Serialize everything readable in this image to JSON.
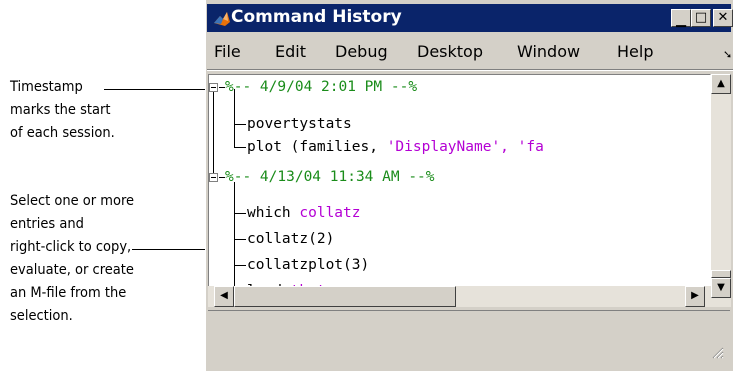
{
  "callouts": {
    "timestamp": {
      "lines": [
        "Timestamp",
        "marks the start",
        "of each session."
      ]
    },
    "select": {
      "lines": [
        "Select one or more",
        "entries and",
        "right-click to copy,",
        "evaluate, or create",
        "an M-file from the",
        "selection."
      ]
    }
  },
  "window": {
    "title": "Command History",
    "icon": "matlab-logo-icon",
    "controls": [
      "minimize-icon",
      "maximize-icon",
      "close-icon"
    ]
  },
  "menu": {
    "items": [
      "File",
      "Edit",
      "Debug",
      "Desktop",
      "Window",
      "Help"
    ],
    "overflow_icon": "chevron-double-right-icon"
  },
  "history": {
    "sessions": [
      {
        "timestamp": "%-- 4/9/04   2:01 PM --%",
        "entries": [
          {
            "text": "povertystats",
            "arg": ""
          },
          {
            "text": "plot (families, ",
            "arg": "'DisplayName', 'fa"
          }
        ]
      },
      {
        "timestamp": "%-- 4/13/04 11:34 AM --%",
        "entries": [
          {
            "text": "which ",
            "arg": "collatz"
          },
          {
            "text": "collatz(2)",
            "arg": ""
          },
          {
            "text": "collatzplot(3)",
            "arg": ""
          },
          {
            "text": "load ",
            "arg": "theta"
          }
        ]
      }
    ]
  },
  "colors": {
    "titlebar": "#0a246a",
    "timestamp": "#1a8c1a",
    "string_arg": "#b400d4",
    "chrome": "#d4d0c8"
  }
}
